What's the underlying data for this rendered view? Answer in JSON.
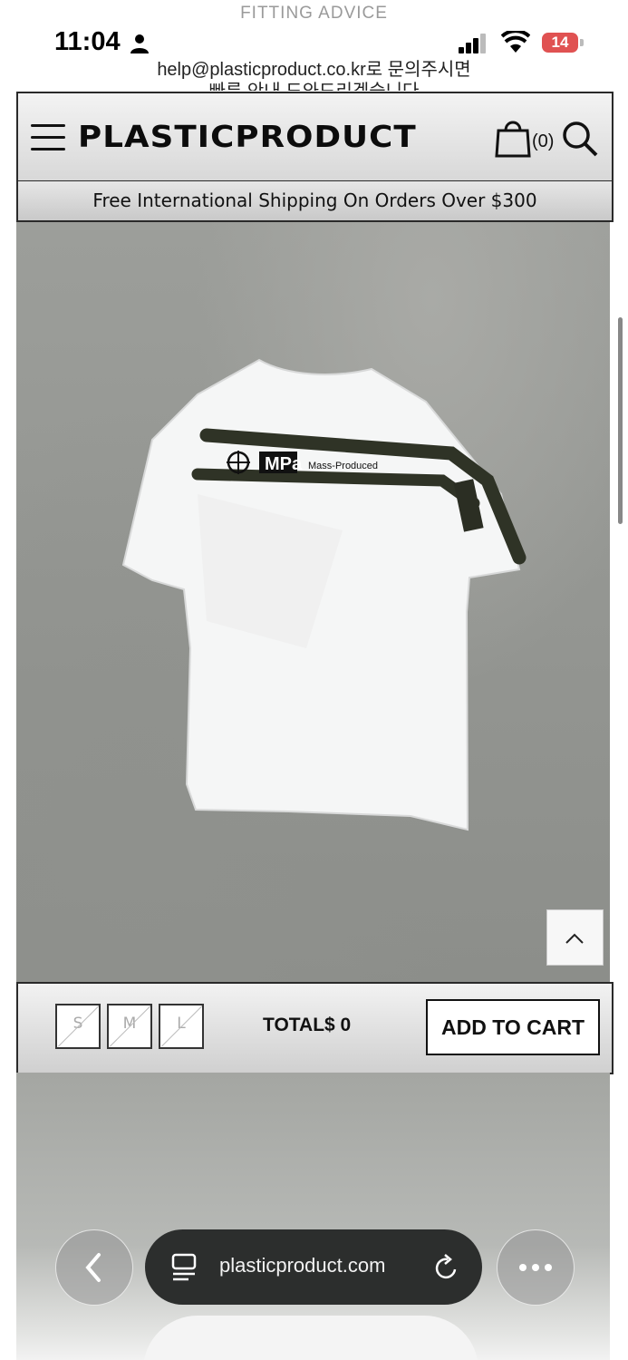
{
  "top_notice": "FITTING ADVICE",
  "status": {
    "time": "11:04",
    "battery": "14"
  },
  "help": {
    "line1": "help@plasticproduct.co.kr로 문의주시면",
    "line2": "빠른 안내 도와드리겠습니다"
  },
  "header": {
    "logo": "PLASTICPRODUCT",
    "cart_count": "(0)"
  },
  "shipping_banner": "Free International Shipping On Orders Over $300",
  "product": {
    "tag_brand": "MPa",
    "tag_text": "Mass-Produced"
  },
  "purchase": {
    "sizes": [
      "S",
      "M",
      "L"
    ],
    "total": "TOTAL$ 0",
    "add_to_cart": "ADD TO CART"
  },
  "browser": {
    "url": "plasticproduct.com"
  },
  "colors": {
    "cart_button_border": "#111111",
    "battery_low": "#e05252",
    "url_bar": "#2c2e2d"
  }
}
